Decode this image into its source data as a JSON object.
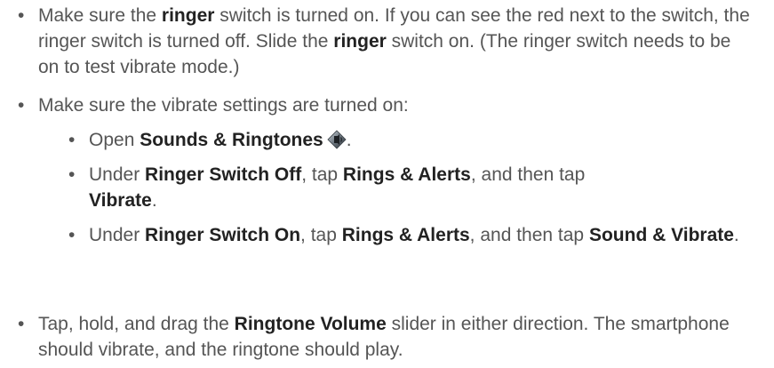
{
  "content": {
    "bullet_char": "•",
    "item1": {
      "t1": "Make sure the ",
      "b1": "ringer",
      "t2": " switch is turned on. If you can see the red next to the switch, the ringer switch is turned off. Slide the ",
      "b2": "ringer",
      "t3": " switch on. (The ringer switch needs to be on to test vibrate mode.)"
    },
    "item2": {
      "t1": "Make sure the vibrate settings are turned on:"
    },
    "sub1": {
      "t1": "Open ",
      "b1": "Sounds & Ringtones",
      "icon": "sounds-ringtones-icon",
      "t2": "."
    },
    "sub2": {
      "t1": "Under ",
      "b1": "Ringer Switch Off",
      "t2": ", tap ",
      "b2": "Rings & Alerts",
      "t3": ", and then tap ",
      "b3": "Vibrate",
      "t4": "."
    },
    "sub3": {
      "t1": "Under ",
      "b1": "Ringer Switch On",
      "t2": ", tap ",
      "b2": "Rings & Alerts",
      "t3": ", and then tap ",
      "b3": "Sound & Vibrate",
      "t4": "."
    },
    "item3": {
      "t1": "Tap, hold, and drag the ",
      "b1": "Ringtone Volume",
      "t2": " slider in either direction. The smartphone should vibrate, and the ringtone should play."
    }
  }
}
